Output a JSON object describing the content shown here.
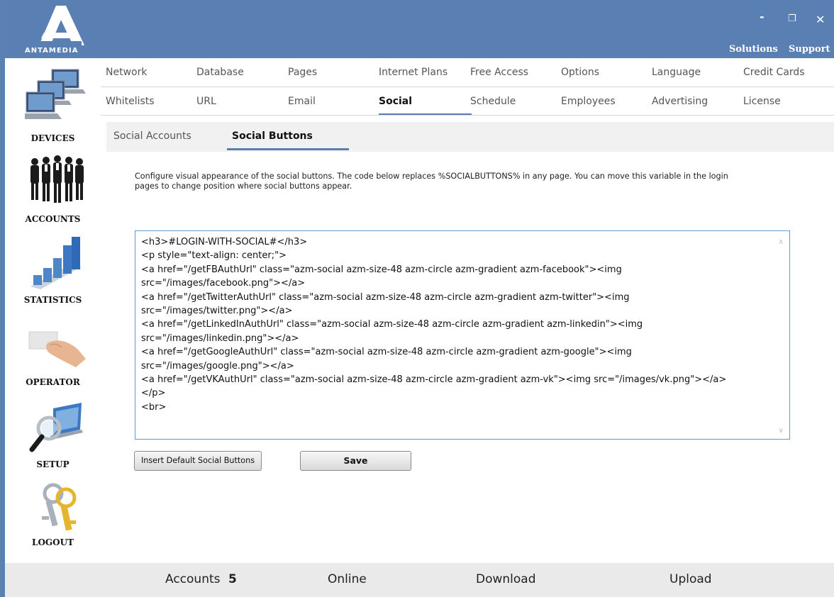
{
  "brand": {
    "name": "ANTAMEDIA",
    "header_color": "#5a7fb3"
  },
  "window_controls": {
    "minimize": "-",
    "restore": "❐",
    "close": "✕"
  },
  "top_links": {
    "solutions": "Solutions",
    "support": "Support"
  },
  "sidebar": {
    "items": [
      {
        "label": "DEVICES",
        "icon": "devices-icon"
      },
      {
        "label": "ACCOUNTS",
        "icon": "accounts-icon"
      },
      {
        "label": "STATISTICS",
        "icon": "statistics-icon"
      },
      {
        "label": "OPERATOR",
        "icon": "operator-icon"
      },
      {
        "label": "SETUP",
        "icon": "setup-icon"
      },
      {
        "label": "LOGOUT",
        "icon": "logout-icon"
      }
    ]
  },
  "tabs": {
    "row1": [
      "Network",
      "Database",
      "Pages",
      "Internet Plans",
      "Free Access",
      "Options",
      "Language",
      "Credit Cards"
    ],
    "row2": [
      "Whitelists",
      "URL",
      "Email",
      "Social",
      "Schedule",
      "Employees",
      "Advertising",
      "License"
    ],
    "active": "Social"
  },
  "subtabs": {
    "items": [
      "Social Accounts",
      "Social Buttons"
    ],
    "active": "Social Buttons"
  },
  "description": "Configure visual appearance of the social buttons. The code below replaces %SOCIALBUTTONS% in any page. You can move this variable in the login pages to change position where social buttons appear.",
  "editor": {
    "lines": [
      "<h3>#LOGIN-WITH-SOCIAL#</h3>",
      "<p style=\"text-align: center;\">",
      "<a href=\"/getFBAuthUrl\" class=\"azm-social azm-size-48 azm-circle azm-gradient azm-facebook\"><img",
      "src=\"/images/facebook.png\"></a>",
      "<a href=\"/getTwitterAuthUrl\" class=\"azm-social azm-size-48 azm-circle azm-gradient azm-twitter\"><img",
      "src=\"/images/twitter.png\"></a>",
      "<a href=\"/getLinkedInAuthUrl\" class=\"azm-social azm-size-48 azm-circle azm-gradient azm-linkedin\"><img",
      "src=\"/images/linkedin.png\"></a>",
      "<a href=\"/getGoogleAuthUrl\" class=\"azm-social azm-size-48 azm-circle azm-gradient azm-google\"><img",
      "src=\"/images/google.png\"></a>",
      "<a href=\"/getVKAuthUrl\" class=\"azm-social azm-size-48 azm-circle azm-gradient azm-vk\"><img src=\"/images/vk.png\"></a>",
      "</p>",
      "<br>"
    ]
  },
  "buttons": {
    "insert_default": "Insert Default Social Buttons",
    "save": "Save"
  },
  "footer": {
    "accounts_label": "Accounts",
    "accounts_count": "5",
    "online_label": "Online",
    "download_label": "Download",
    "upload_label": "Upload"
  }
}
